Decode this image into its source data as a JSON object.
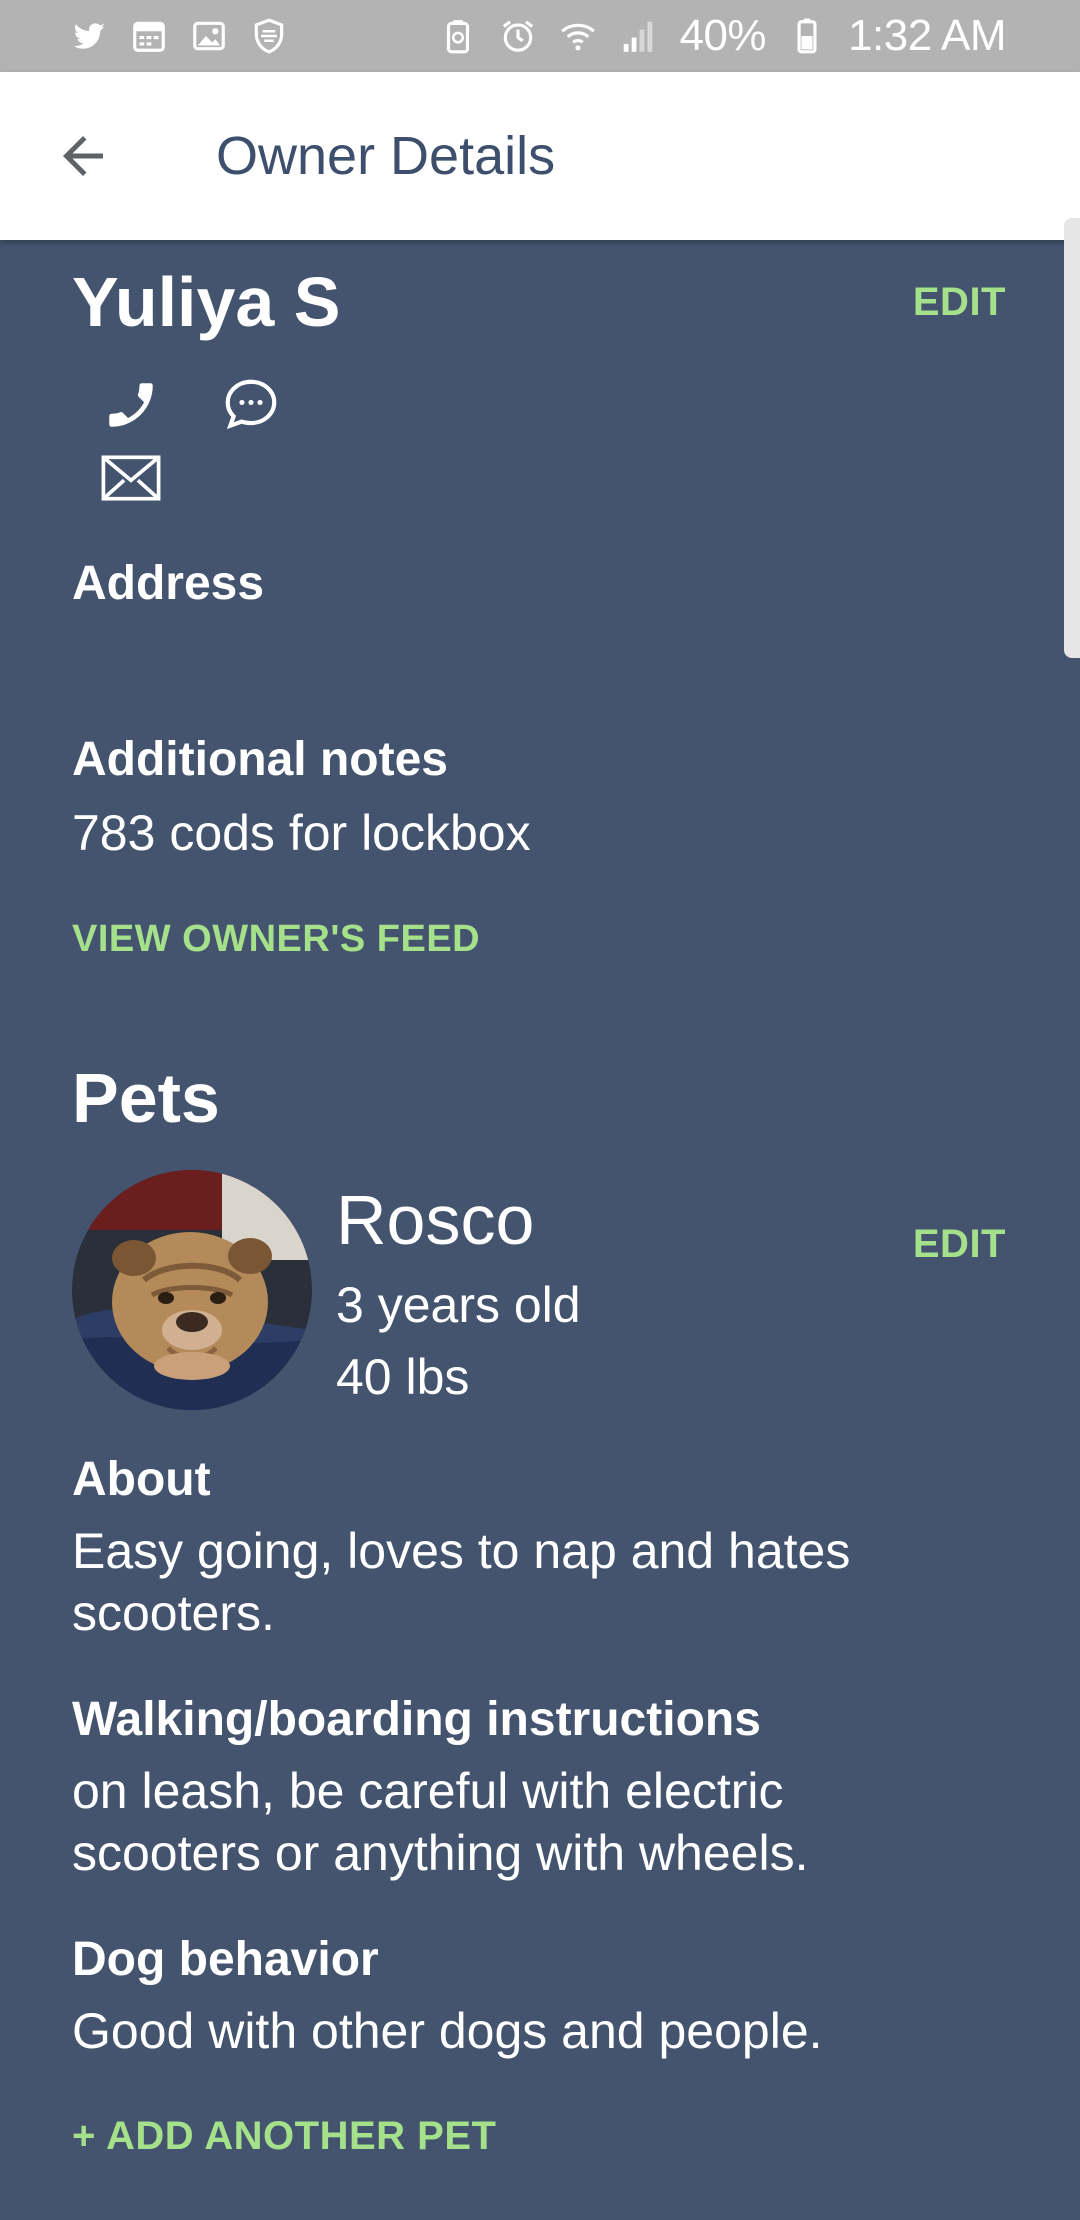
{
  "status_bar": {
    "battery": "40%",
    "time": "1:32 AM"
  },
  "app_bar": {
    "title": "Owner Details"
  },
  "owner": {
    "name": "Yuliya S",
    "edit_label": "EDIT",
    "address_label": "Address",
    "notes_label": "Additional notes",
    "notes_value": "783 cods for lockbox",
    "view_feed_label": "VIEW OWNER'S FEED"
  },
  "pets_section": {
    "heading": "Pets",
    "add_pet_label": "+ ADD ANOTHER PET"
  },
  "pet": {
    "name": "Rosco",
    "age": "3 years old",
    "weight": "40 lbs",
    "edit_label": "EDIT",
    "about_label": "About",
    "about_value": "Easy going, loves to nap and hates scooters.",
    "walking_label": "Walking/boarding instructions",
    "walking_value": "on leash, be careful with electric scooters or anything with wheels.",
    "behavior_label": "Dog behavior",
    "behavior_value": "Good with other dogs and people."
  },
  "colors": {
    "background": "#44546f",
    "accent": "#a5e08a",
    "title_text": "#3d4f6c",
    "status_bar": "#b3b3b3"
  },
  "icons": {
    "status_left": [
      "twitter-icon",
      "calendar-icon",
      "image-icon",
      "shield-icon"
    ],
    "status_right": [
      "battery-saver-icon",
      "alarm-icon",
      "wifi-icon",
      "signal-icon",
      "battery-icon"
    ],
    "owner_contacts": [
      "phone-icon",
      "chat-icon",
      "mail-icon"
    ]
  }
}
